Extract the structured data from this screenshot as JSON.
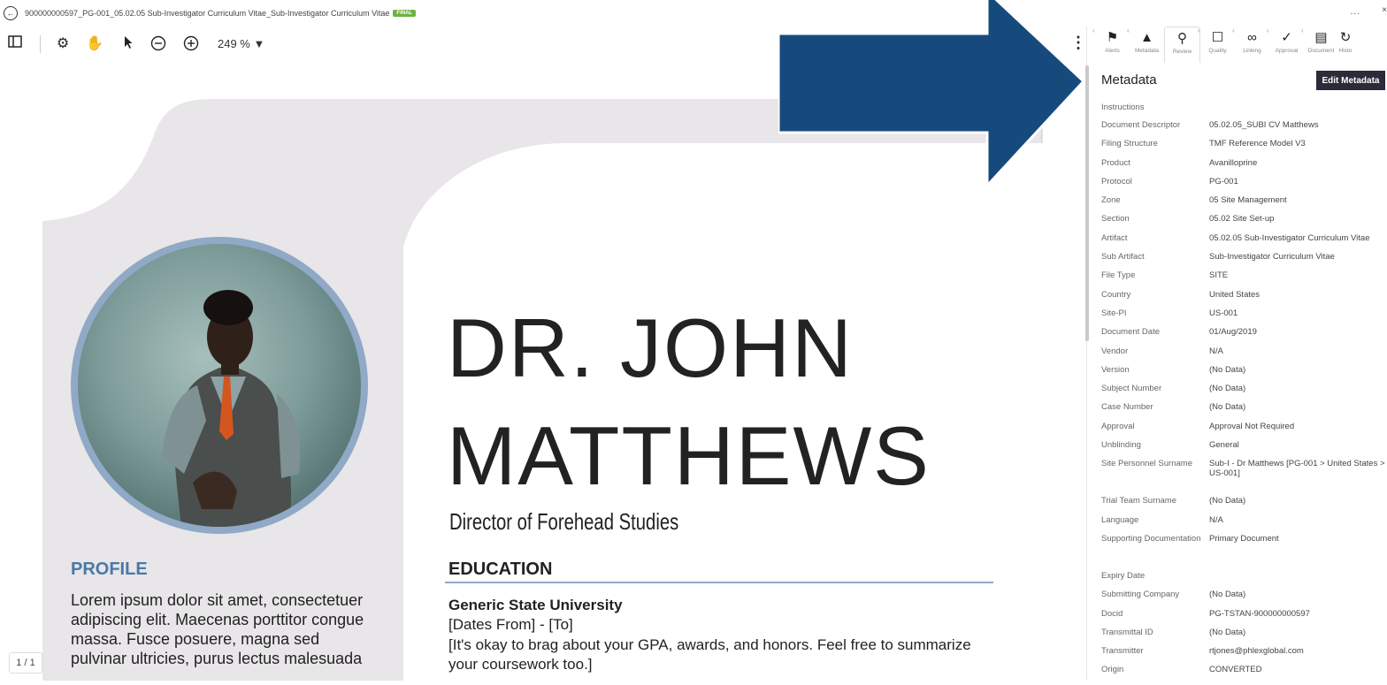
{
  "window": {
    "title": "900000000597_PG-001_05.02.05 Sub-Investigator Curriculum Vitae_Sub-Investigator Curriculum Vitae",
    "status_badge": "FINAL",
    "more": "...",
    "close": "×"
  },
  "toolbar": {
    "zoom": "249 % ▼"
  },
  "document": {
    "name_line1": "DR. JOHN",
    "name_line2": "MATTHEWS",
    "role": "Director of Forehead Studies",
    "profile_heading": "PROFILE",
    "profile_text": "Lorem ipsum dolor sit amet, consectetuer adipiscing elit. Maecenas porttitor congue massa. Fusce posuere, magna sed pulvinar ultricies, purus lectus malesuada",
    "education_heading": "EDUCATION",
    "school": "Generic State University",
    "dates": "[Dates From] - [To]",
    "description": "[It's okay to brag about your GPA, awards, and honors. Feel free to summarize your coursework too.]",
    "page_indicator": "1 / 1"
  },
  "panel": {
    "tabs": [
      {
        "label": "Alerts",
        "icon": "flag-icon"
      },
      {
        "label": "Metadata",
        "icon": "tag-icon"
      },
      {
        "label": "Review",
        "icon": "search-icon"
      },
      {
        "label": "Quality",
        "icon": "question-box-icon"
      },
      {
        "label": "Linking",
        "icon": "link-icon"
      },
      {
        "label": "Approval",
        "icon": "check-icon"
      },
      {
        "label": "Document",
        "icon": "document-icon"
      },
      {
        "label": "Histo",
        "icon": "history-icon"
      }
    ],
    "title": "Metadata",
    "edit_button": "Edit Metadata",
    "instructions": "Instructions",
    "fields": [
      {
        "k": "Document Descriptor",
        "v": "05.02.05_SUBI CV Matthews"
      },
      {
        "k": "Filing Structure",
        "v": "TMF Reference Model V3"
      },
      {
        "k": "Product",
        "v": "Avanilloprine"
      },
      {
        "k": "Protocol",
        "v": "PG-001"
      },
      {
        "k": "Zone",
        "v": "05 Site Management"
      },
      {
        "k": "Section",
        "v": "05.02 Site Set-up"
      },
      {
        "k": "Artifact",
        "v": "05.02.05 Sub-Investigator Curriculum Vitae"
      },
      {
        "k": "Sub Artifact",
        "v": "Sub-Investigator Curriculum Vitae"
      },
      {
        "k": "File Type",
        "v": "SITE"
      },
      {
        "k": "Country",
        "v": "United States"
      },
      {
        "k": "Site-PI",
        "v": "US-001"
      },
      {
        "k": "Document Date",
        "v": "01/Aug/2019"
      },
      {
        "k": "Vendor",
        "v": "N/A"
      },
      {
        "k": "Version",
        "v": "(No Data)"
      },
      {
        "k": "Subject Number",
        "v": "(No Data)"
      },
      {
        "k": "Case Number",
        "v": "(No Data)"
      },
      {
        "k": "Approval",
        "v": "Approval Not Required"
      },
      {
        "k": "Unblinding",
        "v": "General"
      },
      {
        "k": "Site Personnel Surname",
        "v": "Sub-I - Dr Matthews [PG-001 > United States > US-001]"
      },
      {
        "k": "Trial Team Surname",
        "v": "(No Data)"
      },
      {
        "k": "Language",
        "v": "N/A"
      },
      {
        "k": "Supporting Documentation",
        "v": "Primary Document"
      },
      {
        "k": "Expiry Date",
        "v": ""
      },
      {
        "k": "Submitting Company",
        "v": "(No Data)"
      },
      {
        "k": "Docid",
        "v": "PG-TSTAN-900000000597"
      },
      {
        "k": "Transmittal ID",
        "v": "(No Data)"
      },
      {
        "k": "Transmitter",
        "v": "rtjones@phlexglobal.com"
      },
      {
        "k": "Origin",
        "v": "CONVERTED"
      }
    ]
  },
  "colors": {
    "arrow": "#174a7c",
    "accent_blue": "#4a78a8",
    "final_badge": "#6cb33f",
    "edit_button": "#2b2b3a"
  }
}
